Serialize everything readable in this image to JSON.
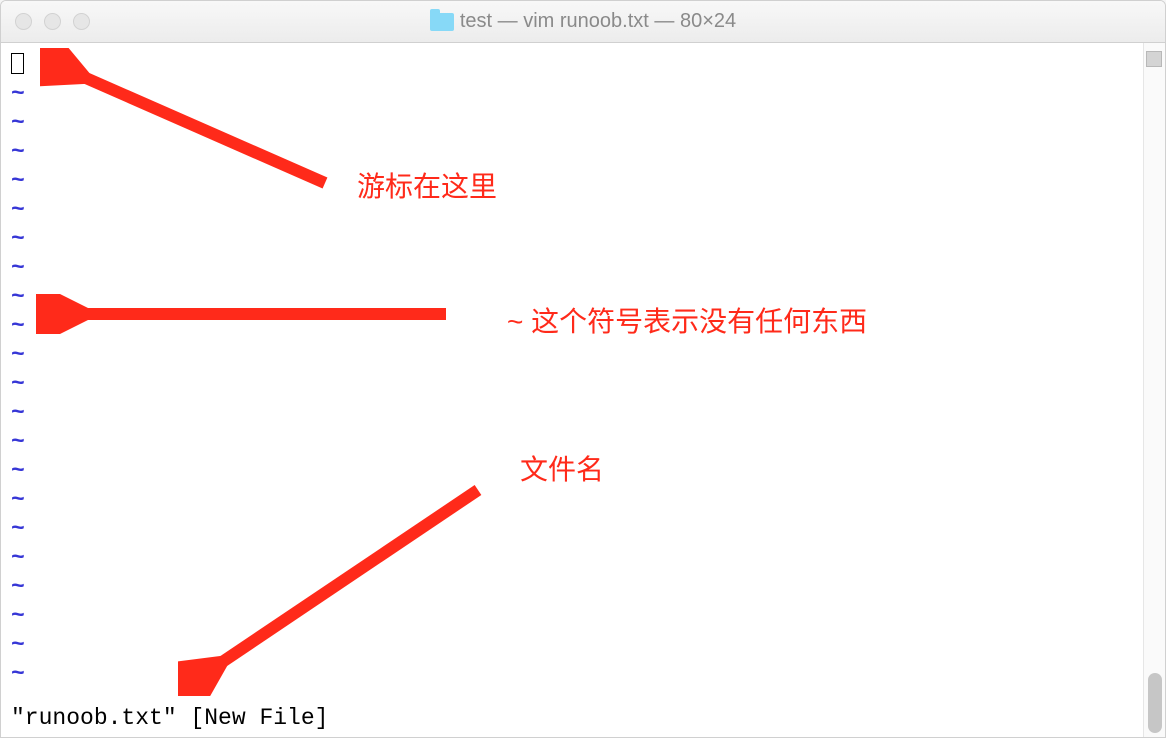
{
  "titlebar": {
    "title": "test — vim runoob.txt — 80×24"
  },
  "terminal": {
    "tilde": "~",
    "status_line": "\"runoob.txt\" [New File]"
  },
  "annotations": {
    "cursor_label": "游标在这里",
    "tilde_label": "~ 这个符号表示没有任何东西",
    "filename_label": "文件名"
  }
}
